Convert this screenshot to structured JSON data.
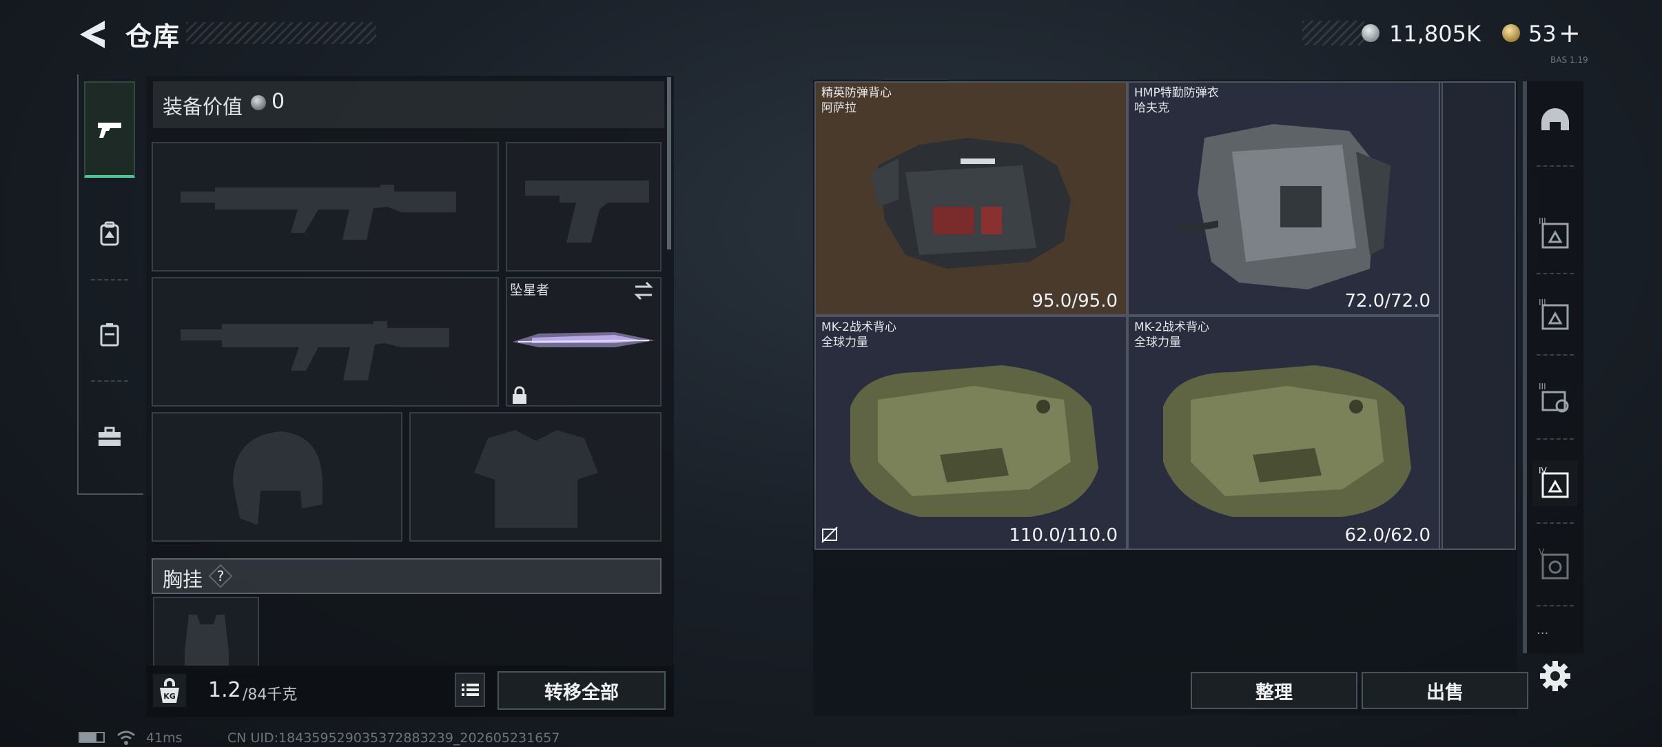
{
  "header": {
    "title": "仓库",
    "currency_silver": "11,805K",
    "currency_gold": "53",
    "gold_plus": "+",
    "corner_tag": "BAS 1.19"
  },
  "left_tabs": [
    "weapon-tab",
    "backpack-tab",
    "container-tab",
    "toolbox-tab"
  ],
  "equipment": {
    "value_label": "装备价值",
    "value": "0",
    "knife_name": "坠星者",
    "rig_label": "胸挂",
    "rig_help": "?",
    "weight": "1.2",
    "weight_unit": "/84千克",
    "kg_badge": "KG",
    "transfer_all": "转移全部"
  },
  "items": [
    {
      "name": "精英防弹背心",
      "sub": "阿萨拉",
      "durability": "95.0/95.0",
      "highlight": "#4a3a2c"
    },
    {
      "name": "HMP特勤防弹衣",
      "sub": "哈夫克",
      "durability": "72.0/72.0",
      "highlight": "#2a2d3e"
    },
    {
      "name": "MK-2战术背心",
      "sub": "全球力量",
      "durability": "110.0/110.0",
      "highlight": "#2a2d3e"
    },
    {
      "name": "MK-2战术背心",
      "sub": "全球力量",
      "durability": "62.0/62.0",
      "highlight": "#2a2d3e"
    }
  ],
  "actions": {
    "sort": "整理",
    "sell": "出售"
  },
  "filters": [
    {
      "icon": "helmet-icon"
    },
    {
      "icon": "armor-tier-3-icon",
      "badge": "III"
    },
    {
      "icon": "armor-tier-3b-icon",
      "badge": "III"
    },
    {
      "icon": "armor-tier-3c-icon",
      "badge": "III"
    },
    {
      "icon": "armor-tier-4-icon",
      "badge": "IV"
    },
    {
      "icon": "armor-tier-5-icon",
      "badge": "V"
    }
  ],
  "filters_more": "...",
  "status": {
    "ping": "41ms",
    "uid": "CN UID:184359529035372883239_202605231657"
  }
}
